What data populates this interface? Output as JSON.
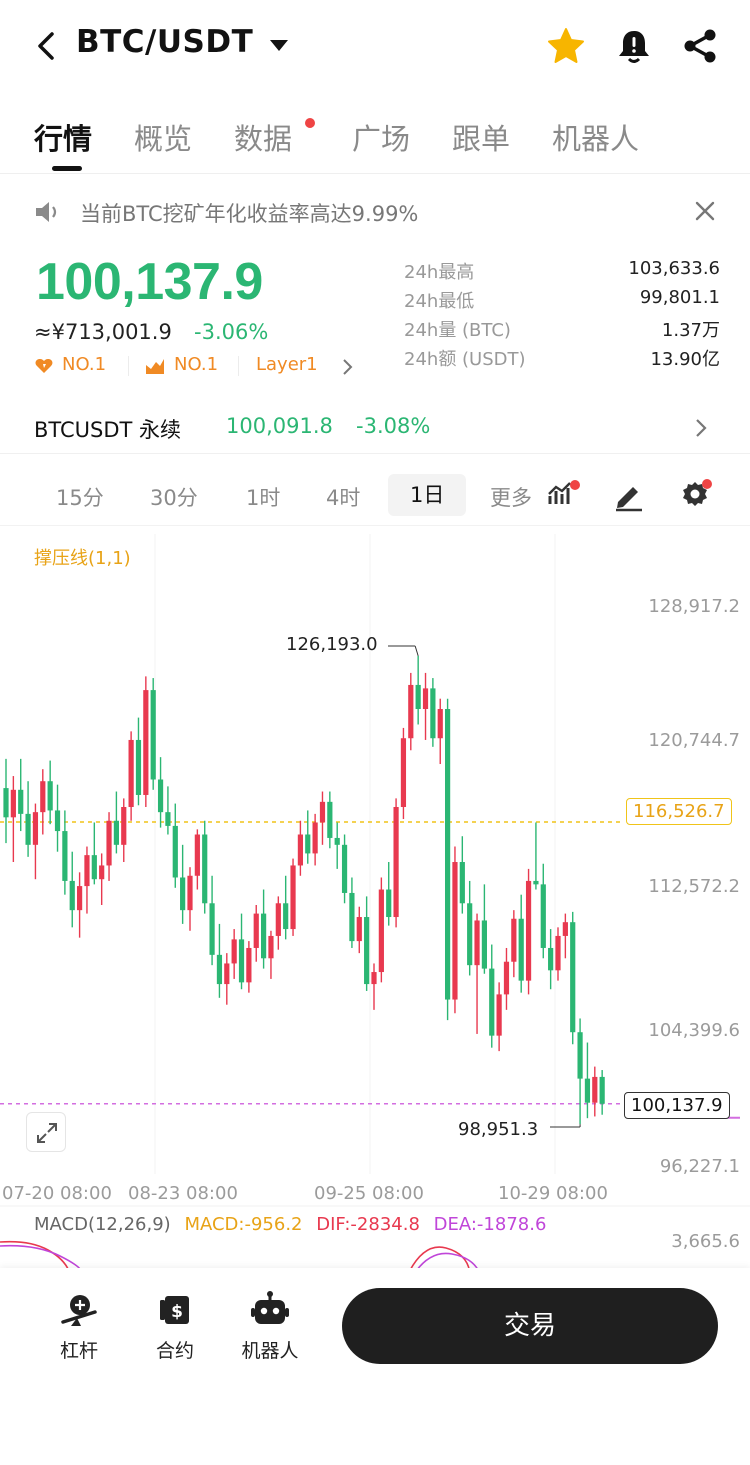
{
  "header": {
    "pair": "BTC/USDT",
    "icons": [
      "back-arrow-icon",
      "caret-down-icon",
      "star-icon",
      "bell-alert-icon",
      "share-icon"
    ]
  },
  "tabs": [
    {
      "label": "行情",
      "active": true
    },
    {
      "label": "概览",
      "active": false
    },
    {
      "label": "数据",
      "active": false,
      "dot": true
    },
    {
      "label": "广场",
      "active": false
    },
    {
      "label": "跟单",
      "active": false
    },
    {
      "label": "机器人",
      "active": false
    }
  ],
  "notice": {
    "text": "当前BTC挖矿年化收益率高达9.99%"
  },
  "price": {
    "last": "100,137.9",
    "cny": "≈¥713,001.9",
    "change": "-3.06%",
    "badges": [
      {
        "label": "NO.1",
        "icon": "heart-fire-icon"
      },
      {
        "label": "NO.1",
        "icon": "chart-fire-icon"
      },
      {
        "label": "Layer1"
      }
    ]
  },
  "stats": [
    {
      "label": "24h最高",
      "value": "103,633.6"
    },
    {
      "label": "24h最低",
      "value": "99,801.1"
    },
    {
      "label": "24h量 (BTC)",
      "value": "1.37万"
    },
    {
      "label": "24h额 (USDT)",
      "value": "13.90亿"
    }
  ],
  "perpetual": {
    "name": "BTCUSDT 永续",
    "price": "100,091.8",
    "change": "-3.08%"
  },
  "intervals": [
    {
      "label": "15分"
    },
    {
      "label": "30分"
    },
    {
      "label": "1时"
    },
    {
      "label": "4时"
    },
    {
      "label": "1日",
      "active": true
    },
    {
      "label": "更多"
    }
  ],
  "chart": {
    "indicator": "撑压线(1,1)",
    "y_ticks": [
      "128,917.2",
      "120,744.7",
      "112,572.2",
      "104,399.6",
      "96,227.1"
    ],
    "x_ticks": [
      "07-20 08:00",
      "08-23 08:00",
      "09-25 08:00",
      "10-29 08:00"
    ],
    "resistance_label": "116,526.7",
    "current_price_label": "100,137.9",
    "high_label": "126,193.0",
    "low_label": "98,951.3",
    "macd": {
      "name": "MACD(12,26,9)",
      "macd": "MACD:-956.2",
      "dif": "DIF:-2834.8",
      "dea": "DEA:-1878.6",
      "axis": "3,665.6"
    },
    "colors": {
      "up": "#e8394f",
      "down": "#2bb673",
      "resistance": "#f0c419",
      "current": "#d36ee0"
    }
  },
  "bottom_nav": [
    {
      "label": "杠杆",
      "icon": "leverage-icon"
    },
    {
      "label": "合约",
      "icon": "contract-icon"
    },
    {
      "label": "机器人",
      "icon": "robot-icon"
    }
  ],
  "trade_button": "交易",
  "chart_data": {
    "type": "candlestick",
    "title": "",
    "ylim": [
      96227.1,
      128917.2
    ],
    "resistance": 116526.7,
    "current": 100137.9,
    "high": 126193.0,
    "low": 98951.3,
    "candles": [
      [
        118500,
        120200,
        115300,
        116800
      ],
      [
        116800,
        119200,
        114200,
        118400
      ],
      [
        118400,
        120200,
        116000,
        117000
      ],
      [
        117000,
        118900,
        114500,
        115200
      ],
      [
        115200,
        117600,
        113200,
        117100
      ],
      [
        117100,
        119600,
        115800,
        118900
      ],
      [
        118900,
        120100,
        116400,
        117200
      ],
      [
        117200,
        118700,
        114800,
        116000
      ],
      [
        116000,
        117200,
        112300,
        113100
      ],
      [
        113100,
        114800,
        110400,
        111400
      ],
      [
        111400,
        113600,
        109800,
        112800
      ],
      [
        112800,
        115100,
        111200,
        114600
      ],
      [
        114600,
        116500,
        112900,
        113200
      ],
      [
        113200,
        114700,
        111700,
        114000
      ],
      [
        114000,
        117100,
        113100,
        116600
      ],
      [
        116600,
        118300,
        114700,
        115200
      ],
      [
        115200,
        117900,
        114200,
        117400
      ],
      [
        117400,
        121800,
        116600,
        121300
      ],
      [
        121300,
        122600,
        117500,
        118100
      ],
      [
        118100,
        125000,
        117400,
        124200
      ],
      [
        124200,
        124900,
        118400,
        119000
      ],
      [
        119000,
        120300,
        116200,
        117100
      ],
      [
        117100,
        118600,
        115800,
        116300
      ],
      [
        116300,
        117600,
        112700,
        113300
      ],
      [
        113300,
        115200,
        110600,
        111400
      ],
      [
        111400,
        113900,
        110200,
        113400
      ],
      [
        113400,
        116100,
        112600,
        115800
      ],
      [
        115800,
        116600,
        111200,
        111800
      ],
      [
        111800,
        113400,
        108200,
        108800
      ],
      [
        108800,
        110600,
        106300,
        107100
      ],
      [
        107100,
        108900,
        105900,
        108300
      ],
      [
        108300,
        110300,
        107400,
        109700
      ],
      [
        109700,
        111200,
        106800,
        107200
      ],
      [
        107200,
        109600,
        106600,
        109200
      ],
      [
        109200,
        111700,
        108400,
        111200
      ],
      [
        111200,
        112600,
        108000,
        108600
      ],
      [
        108600,
        110200,
        107400,
        109900
      ],
      [
        109900,
        112200,
        109100,
        111800
      ],
      [
        111800,
        113400,
        109700,
        110300
      ],
      [
        110300,
        114400,
        109900,
        114000
      ],
      [
        114000,
        116600,
        113400,
        115800
      ],
      [
        115800,
        117200,
        114100,
        114700
      ],
      [
        114700,
        117000,
        114000,
        116500
      ],
      [
        116500,
        118300,
        115200,
        117700
      ],
      [
        117700,
        118300,
        115000,
        115600
      ],
      [
        115600,
        116500,
        113800,
        115200
      ],
      [
        115200,
        115800,
        111800,
        112400
      ],
      [
        112400,
        113300,
        109200,
        109600
      ],
      [
        109600,
        111600,
        108900,
        111000
      ],
      [
        111000,
        112200,
        106700,
        107100
      ],
      [
        107100,
        108300,
        105600,
        107800
      ],
      [
        107800,
        113300,
        107200,
        112600
      ],
      [
        112600,
        114200,
        110500,
        111000
      ],
      [
        111000,
        117900,
        110400,
        117400
      ],
      [
        117400,
        122000,
        116700,
        121400
      ],
      [
        121400,
        125200,
        120700,
        124500
      ],
      [
        124500,
        126193,
        122200,
        123100
      ],
      [
        123100,
        125200,
        121300,
        124300
      ],
      [
        124300,
        124900,
        120900,
        121400
      ],
      [
        121400,
        123700,
        119900,
        123100
      ],
      [
        123100,
        123700,
        105000,
        106200
      ],
      [
        106200,
        115100,
        105400,
        114200
      ],
      [
        114200,
        115700,
        111200,
        111800
      ],
      [
        111800,
        113100,
        107600,
        108200
      ],
      [
        108200,
        111200,
        104200,
        110800
      ],
      [
        110800,
        112900,
        107700,
        108000
      ],
      [
        108000,
        109400,
        103400,
        104100
      ],
      [
        104100,
        107200,
        103200,
        106500
      ],
      [
        106500,
        109200,
        105600,
        108400
      ],
      [
        108400,
        111400,
        107500,
        110900
      ],
      [
        110900,
        112300,
        106600,
        107300
      ],
      [
        107300,
        113800,
        106500,
        113100
      ],
      [
        113100,
        116500,
        112600,
        112900
      ],
      [
        112900,
        114100,
        108600,
        109200
      ],
      [
        109200,
        110300,
        106800,
        107900
      ],
      [
        107900,
        110400,
        107300,
        109900
      ],
      [
        109900,
        111200,
        108600,
        110700
      ],
      [
        110700,
        111300,
        103600,
        104300
      ],
      [
        104300,
        105100,
        98951,
        101600
      ],
      [
        101600,
        103700,
        99300,
        100200
      ],
      [
        100200,
        102300,
        99400,
        101700
      ],
      [
        101700,
        102100,
        99500,
        100138
      ]
    ]
  }
}
